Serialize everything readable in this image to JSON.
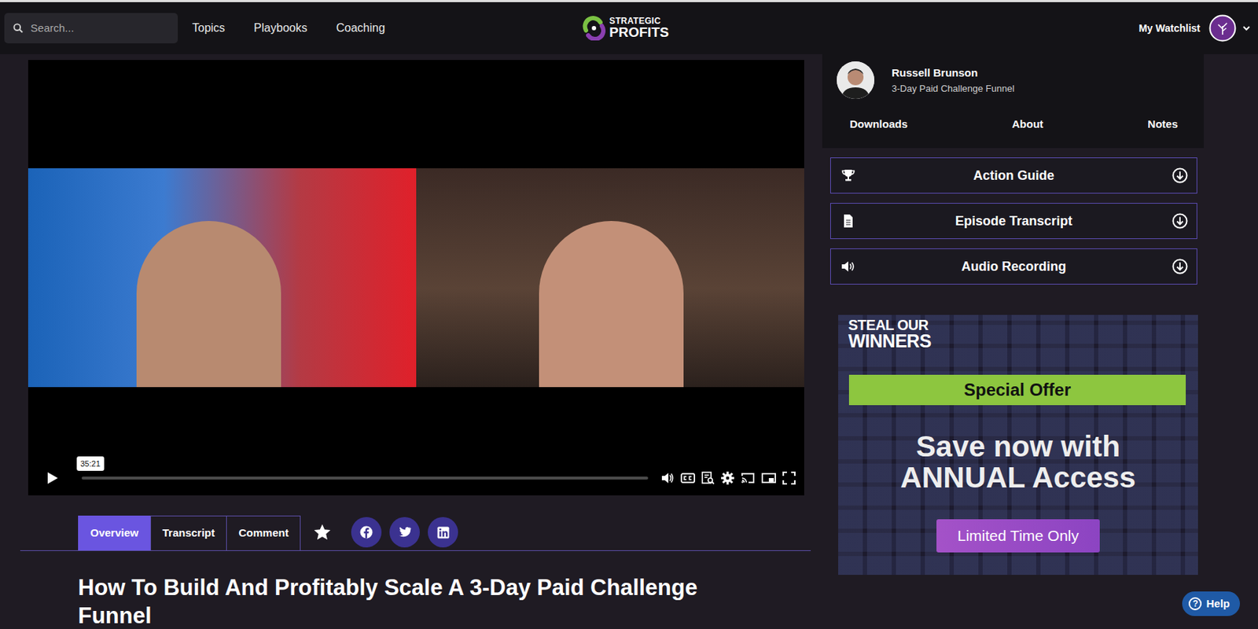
{
  "header": {
    "search": {
      "placeholder": "Search..."
    },
    "nav": [
      "Topics",
      "Playbooks",
      "Coaching"
    ],
    "logo": [
      "STRATEGIC",
      "PROFITS"
    ],
    "watchlist": "My Watchlist"
  },
  "video": {
    "tooltip": "35:21",
    "level": 0.0
  },
  "tabs": [
    {
      "label": "Overview",
      "selected": true
    },
    {
      "label": "Transcript",
      "selected": false
    },
    {
      "label": "Comment",
      "selected": false
    }
  ],
  "title": "How To Build And Profitably Scale A 3-Day Paid Challenge Funnel",
  "author": {
    "name": "Russell Brunson",
    "subtitle": "3-Day Paid Challenge Funnel"
  },
  "sidebar_tabs": [
    "Downloads",
    "About",
    "Notes"
  ],
  "downloads": [
    {
      "label": "Action Guide",
      "kind": "trophy"
    },
    {
      "label": "Episode Transcript",
      "kind": "document"
    },
    {
      "label": "Audio Recording",
      "kind": "audio"
    }
  ],
  "ad": {
    "brand": [
      "STEAL OUR",
      "WINNERS"
    ],
    "banner": "Special Offer",
    "headline": [
      "Save now with",
      "ANNUAL Access"
    ],
    "button": "Limited Time Only"
  },
  "help": {
    "icon": "?",
    "label": "Help"
  }
}
